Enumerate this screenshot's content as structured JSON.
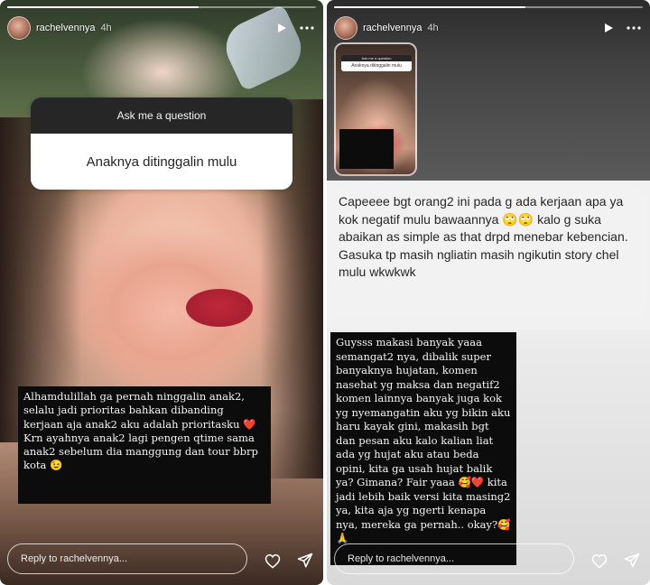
{
  "left_story": {
    "progress_fill": 0.62,
    "username": "rachelvennya",
    "time": "4h",
    "question_sticker": {
      "title": "Ask me a question",
      "answer": "Anaknya ditinggalin mulu"
    },
    "caption": {
      "paragraph1": "Alhamdulillah ga pernah ninggalin anak2, selalu jadi prioritas bahkan dibanding kerjaan aja anak2 aku adalah prioritasku ❤️",
      "paragraph2": "Krn ayahnya anak2 lagi pengen qtime sama anak2 sebelum dia manggung dan tour bbrp kota 😉"
    },
    "reply_placeholder": "Reply to rachelvennya..."
  },
  "right_story": {
    "progress_fill": 0.62,
    "username": "rachelvennya",
    "time": "4h",
    "thumbnail": {
      "question_title": "Ask me a question",
      "question_answer": "Anaknya ditinggalin mulu"
    },
    "comment": "Capeeee bgt orang2 ini pada g ada kerjaan apa ya kok negatif mulu bawaannya 🙄🙄 kalo g suka abaikan as simple as that drpd menebar kebencian. Gasuka tp masih ngliatin masih ngikutin story chel mulu wkwkwk",
    "caption": "Guysss makasi banyak yaaa semangat2 nya, dibalik super banyaknya hujatan, komen nasehat yg maksa dan negatif2 komen lainnya banyak juga kok yg nyemangatin aku yg bikin aku haru kayak gini, makasih bgt dan pesan aku kalo kalian liat ada yg hujat aku atau beda opini, kita ga usah hujat balik ya? Gimana? Fair yaaa 🥰❤️ kita jadi lebih baik versi kita masing2 ya, kita aja yg ngerti kenapa nya, mereka ga pernah.. okay?🥰🙏",
    "reply_placeholder": "Reply to rachelvennya..."
  },
  "icons": {
    "play": "play-icon",
    "more": "more-options-icon",
    "like": "heart-icon",
    "send": "send-icon"
  }
}
